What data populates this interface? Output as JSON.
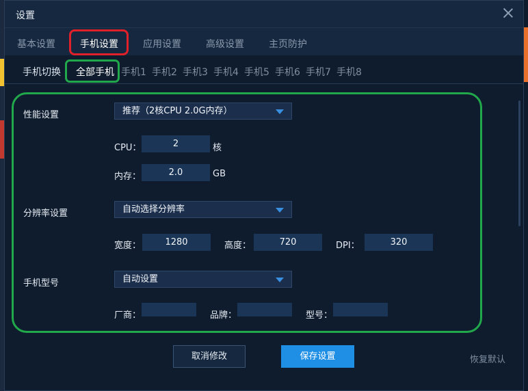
{
  "window": {
    "title": "设置"
  },
  "tabs": [
    {
      "label": "基本设置"
    },
    {
      "label": "手机设置"
    },
    {
      "label": "应用设置"
    },
    {
      "label": "高级设置"
    },
    {
      "label": "主页防护"
    }
  ],
  "active_tab": "手机设置",
  "subtabs": {
    "label": "手机切换",
    "items": [
      "全部手机",
      "手机1",
      "手机2",
      "手机3",
      "手机4",
      "手机5",
      "手机6",
      "手机7",
      "手机8"
    ],
    "active": "全部手机"
  },
  "performance": {
    "label": "性能设置",
    "preset": "推荐（2核CPU 2.0G内存）",
    "cpu_label": "CPU：",
    "cpu_value": "2",
    "cpu_unit": "核",
    "mem_label": "内存：",
    "mem_value": "2.0",
    "mem_unit": "GB"
  },
  "resolution": {
    "label": "分辨率设置",
    "preset": "自动选择分辨率",
    "width_label": "宽度：",
    "width_value": "1280",
    "height_label": "高度：",
    "height_value": "720",
    "dpi_label": "DPI：",
    "dpi_value": "320"
  },
  "model": {
    "label": "手机型号",
    "preset": "自动设置",
    "maker_label": "厂商：",
    "maker_value": "",
    "brand_label": "品牌：",
    "brand_value": "",
    "model_label": "型号：",
    "model_value": ""
  },
  "buttons": {
    "cancel": "取消修改",
    "save": "保存设置",
    "reset": "恢复默认"
  },
  "colors": {
    "accent": "#1f8fe6",
    "highlight_red": "#e0212a",
    "highlight_green": "#21a84a"
  }
}
